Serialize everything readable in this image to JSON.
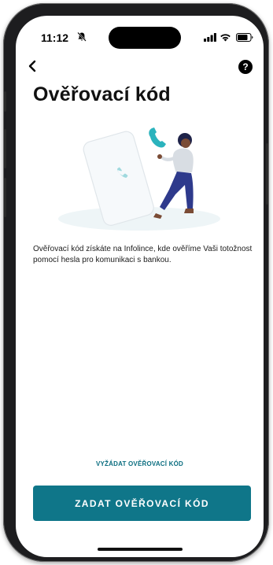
{
  "status_bar": {
    "time": "11:12",
    "icons": [
      "bell-slash-icon",
      "cellular-signal-icon",
      "wifi-icon",
      "battery-icon"
    ]
  },
  "nav": {
    "back_icon": "chevron-left-icon",
    "help_icon": "help-circle-icon",
    "help_label": "?"
  },
  "page": {
    "title": "Ověřovací kód",
    "description": "Ověřovací kód získáte na Infolince, kde ověříme Vaši totožnost pomocí hesla pro komunikaci s bankou."
  },
  "actions": {
    "request_code_label": "VYŽÁDAT OVĚŘOVACÍ KÓD",
    "enter_code_label": "ZADAT OVĚŘOVACÍ KÓD"
  },
  "colors": {
    "accent": "#0f7689",
    "link": "#0b6e80",
    "illustration_teal": "#2bb3bd",
    "illustration_navy": "#2e3a8c"
  }
}
